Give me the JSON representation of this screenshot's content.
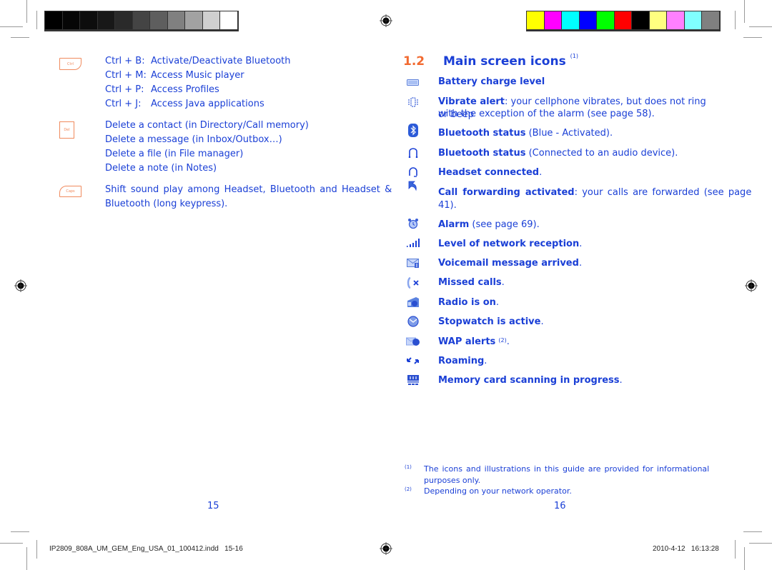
{
  "color_bars": {
    "grayscale": [
      "#000000",
      "#060606",
      "#0d0d0d",
      "#181818",
      "#2a2a2a",
      "#444444",
      "#5e5e5e",
      "#808080",
      "#a2a2a2",
      "#cfcfcf",
      "#ffffff"
    ],
    "colors": [
      "#ffff00",
      "#ff00ff",
      "#00ffff",
      "#0000ff",
      "#00ff00",
      "#ff0000",
      "#000000",
      "#ffff80",
      "#ff80ff",
      "#80ffff",
      "#808080"
    ]
  },
  "left_page": {
    "ctrl_key_label": "Ctrl",
    "ctrl_shortcuts": [
      {
        "key": "Ctrl + B:",
        "action": "Activate/Deactivate Bluetooth"
      },
      {
        "key": "Ctrl + M:",
        "action": "Access Music player"
      },
      {
        "key": "Ctrl + P:",
        "action": "Access Profiles"
      },
      {
        "key": "Ctrl + J:",
        "action": "Access Java applications"
      }
    ],
    "del_key_label": "Del",
    "del_items": [
      "Delete a contact (in Directory/Call memory)",
      "Delete a message (in Inbox/Outbox…)",
      "Delete a file (in File manager)",
      "Delete a note (in Notes)"
    ],
    "caps_key_label": "Caps",
    "caps_text_line1": "Shift  sound  play  among  Headset,  Bluetooth  and  Headset  &",
    "caps_text_line2": "Bluetooth (long keypress).",
    "page_number": "15"
  },
  "right_page": {
    "section_number": "1.2",
    "section_title": "Main screen icons",
    "section_footnote_ref": "(1)",
    "icons": [
      {
        "icon": "battery-icon",
        "bold": "Battery charge level",
        "rest": ""
      },
      {
        "icon": "vibrate-icon",
        "bold": "Vibrate alert",
        "rest": ": your cellphone vibrates, but does not ring or beep",
        "rest2": "with the exception of the alarm (see page 58)."
      },
      {
        "icon": "bluetooth-icon",
        "bold": "Bluetooth status",
        "rest": " (Blue - Activated)."
      },
      {
        "icon": "bluetooth-audio-icon",
        "bold": "Bluetooth status",
        "rest": " (Connected to an audio device)."
      },
      {
        "icon": "headset-icon",
        "bold": "Headset connected",
        "rest": "."
      },
      {
        "icon": "call-forward-icon",
        "bold": "Call  forwarding  activated",
        "rest": ":  your  calls  are  forwarded  (see  page",
        "rest2": "41)."
      },
      {
        "icon": "alarm-icon",
        "bold": "Alarm",
        "rest": " (see page 69)."
      },
      {
        "icon": "signal-icon",
        "bold": "Level of network reception",
        "rest": "."
      },
      {
        "icon": "voicemail-icon",
        "bold": "Voicemail message arrived",
        "rest": "."
      },
      {
        "icon": "missed-calls-icon",
        "bold": "Missed calls",
        "rest": "."
      },
      {
        "icon": "radio-icon",
        "bold": "Radio is on",
        "rest": "."
      },
      {
        "icon": "stopwatch-icon",
        "bold": "Stopwatch is active",
        "rest": "."
      },
      {
        "icon": "wap-alert-icon",
        "bold": "WAP alerts",
        "sup": "(2)",
        "rest": "."
      },
      {
        "icon": "roaming-icon",
        "bold": "Roaming",
        "rest": "."
      },
      {
        "icon": "memory-card-icon",
        "bold": "Memory card scanning in progress",
        "rest": "."
      }
    ],
    "footnotes": [
      {
        "mark": "(1)",
        "line1": "The  icons  and  illustrations  in  this  guide  are  provided  for  informational",
        "line2": "purposes only."
      },
      {
        "mark": "(2)",
        "line1": "Depending on your network operator."
      }
    ],
    "page_number": "16"
  },
  "slug": {
    "filename": "IP2809_808A_UM_GEM_Eng_USA_01_100412.indd   15-16",
    "timestamp": "2010-4-12   16:13:28"
  },
  "colors": {
    "text_blue": "#1a3fd6",
    "heading_orange": "#f26a30",
    "key_orange": "#f08a5d"
  }
}
